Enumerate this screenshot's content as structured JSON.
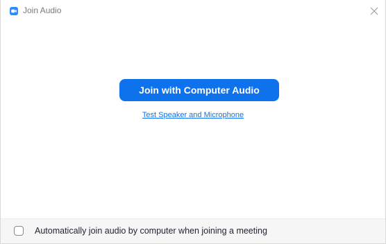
{
  "window": {
    "title": "Join Audio",
    "accent_color": "#0e72ed",
    "app_icon": "zoom-camera-icon",
    "close_icon": "close-icon"
  },
  "main": {
    "join_button_label": "Join with Computer Audio",
    "test_link_label": "Test Speaker and Microphone"
  },
  "footer": {
    "checkbox_label": "Automatically join audio by computer when joining a meeting",
    "checkbox_checked": false
  }
}
